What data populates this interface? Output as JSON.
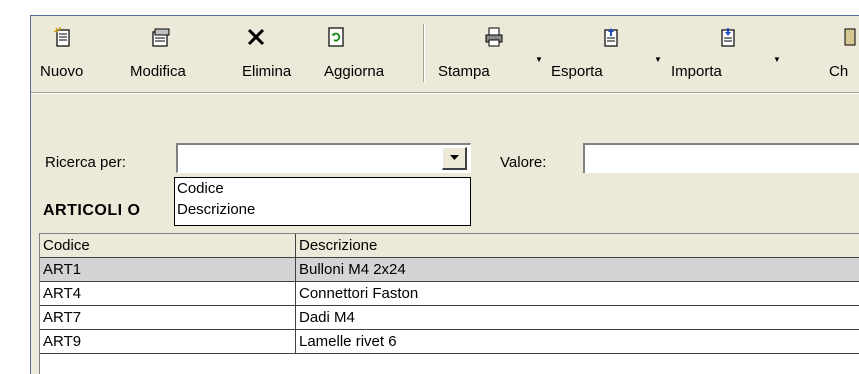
{
  "toolbar": {
    "buttons": [
      {
        "label": "Nuovo",
        "icon": "new-document-icon"
      },
      {
        "label": "Modifica",
        "icon": "edit-icon"
      },
      {
        "label": "Elimina",
        "icon": "delete-x-icon"
      },
      {
        "label": "Aggiorna",
        "icon": "refresh-icon"
      },
      {
        "label": "Stampa",
        "icon": "printer-icon"
      },
      {
        "label": "Esporta",
        "icon": "export-icon"
      },
      {
        "label": "Importa",
        "icon": "import-icon"
      },
      {
        "label": "Ch",
        "icon": "close-icon"
      }
    ]
  },
  "search": {
    "by_label": "Ricerca per:",
    "by_value": "",
    "value_label": "Valore:",
    "value": ""
  },
  "dropdown": {
    "options": [
      "Codice",
      "Descrizione"
    ]
  },
  "section": {
    "title": "ARTICOLI O"
  },
  "grid": {
    "columns": [
      "Codice",
      "Descrizione"
    ],
    "rows": [
      {
        "code": "ART1",
        "desc": "Bulloni M4 2x24",
        "selected": true
      },
      {
        "code": "ART4",
        "desc": "Connettori Faston",
        "selected": false
      },
      {
        "code": "ART7",
        "desc": "Dadi M4",
        "selected": false
      },
      {
        "code": "ART9",
        "desc": "Lamelle rivet 6",
        "selected": false
      }
    ]
  },
  "colors": {
    "window_bg": "#ece9d8",
    "frame": "#5a6a9a",
    "selected_row": "#d4d4d4"
  }
}
